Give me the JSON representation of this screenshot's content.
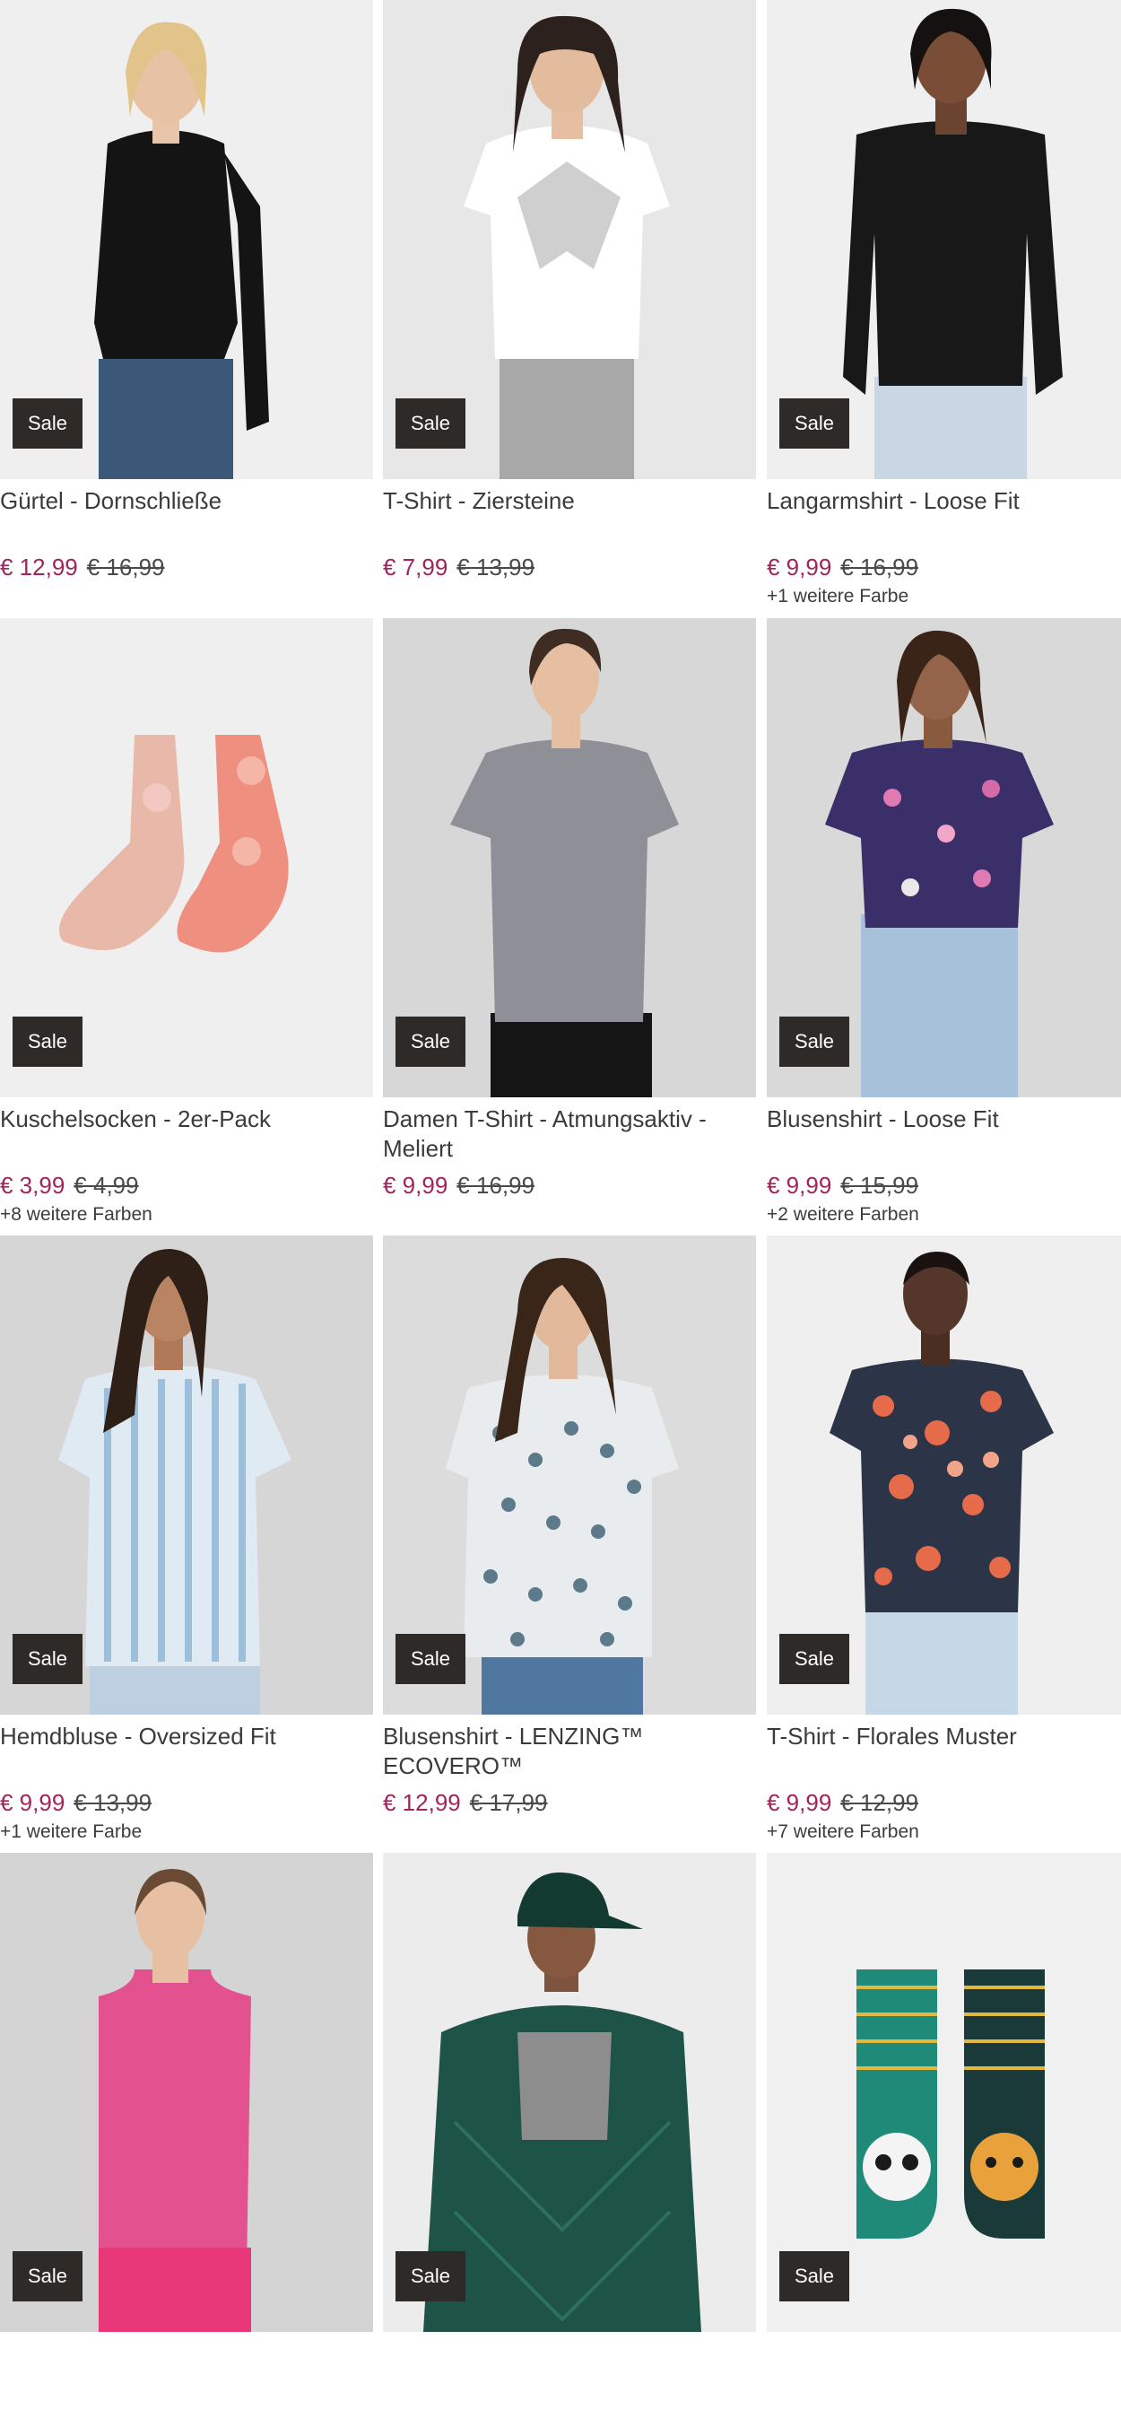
{
  "sale_label": "Sale",
  "accent_color": "#a3245a",
  "products": [
    {
      "title": "Gürtel - Dornschließe",
      "price": "€ 12,99",
      "old_price": "€ 16,99",
      "colors": ""
    },
    {
      "title": "T-Shirt - Ziersteine",
      "price": "€ 7,99",
      "old_price": "€ 13,99",
      "colors": ""
    },
    {
      "title": "Langarmshirt - Loose Fit",
      "price": "€ 9,99",
      "old_price": "€ 16,99",
      "colors": "+1 weitere Farbe"
    },
    {
      "title": "Kuschelsocken - 2er-Pack",
      "price": "€ 3,99",
      "old_price": "€ 4,99",
      "colors": "+8 weitere Farben"
    },
    {
      "title": "Damen T-Shirt - Atmungsaktiv - Meliert",
      "price": "€ 9,99",
      "old_price": "€ 16,99",
      "colors": ""
    },
    {
      "title": "Blusenshirt - Loose Fit",
      "price": "€ 9,99",
      "old_price": "€ 15,99",
      "colors": "+2 weitere Farben"
    },
    {
      "title": "Hemdbluse - Oversized Fit",
      "price": "€ 9,99",
      "old_price": "€ 13,99",
      "colors": "+1 weitere Farbe"
    },
    {
      "title": "Blusenshirt - LENZING™ ECOVERO™",
      "price": "€ 12,99",
      "old_price": "€ 17,99",
      "colors": ""
    },
    {
      "title": "T-Shirt - Florales Muster",
      "price": "€ 9,99",
      "old_price": "€ 12,99",
      "colors": "+7 weitere Farben"
    },
    {
      "title": "",
      "price": "",
      "old_price": "",
      "colors": ""
    },
    {
      "title": "",
      "price": "",
      "old_price": "",
      "colors": ""
    },
    {
      "title": "",
      "price": "",
      "old_price": "",
      "colors": ""
    }
  ]
}
